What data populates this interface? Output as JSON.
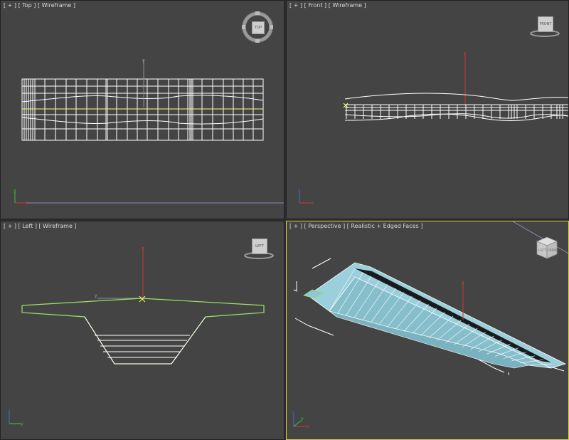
{
  "viewports": {
    "top": {
      "menu_plus": "[ + ]",
      "view_name": "[ Top ]",
      "shading": "[ Wireframe ]",
      "viewcube_label": "TOP"
    },
    "front": {
      "menu_plus": "[ + ]",
      "view_name": "[ Front ]",
      "shading": "[ Wireframe ]",
      "viewcube_label": "FRONT"
    },
    "left": {
      "menu_plus": "[ + ]",
      "view_name": "[ Left ]",
      "shading": "[ Wireframe ]",
      "viewcube_label": "LEFT"
    },
    "perspective": {
      "menu_plus": "[ + ]",
      "view_name": "[ Perspective ]",
      "shading": "[ Realistic + Edged Faces ]",
      "viewcube_label_left": "LEFT",
      "viewcube_label_right": "FRONT",
      "active": true
    }
  },
  "gizmo_axes": {
    "x": "x",
    "y": "y",
    "z": "z"
  },
  "colors": {
    "viewport_bg": "#444444",
    "active_border": "#d8d23c",
    "wire": "#ffffff",
    "selection_green": "#9be36a",
    "axis_red": "#c83a3a",
    "axis_green": "#3cc83c",
    "axis_blue": "#3a6cd8",
    "mesh_face": "#8fc6d2"
  }
}
